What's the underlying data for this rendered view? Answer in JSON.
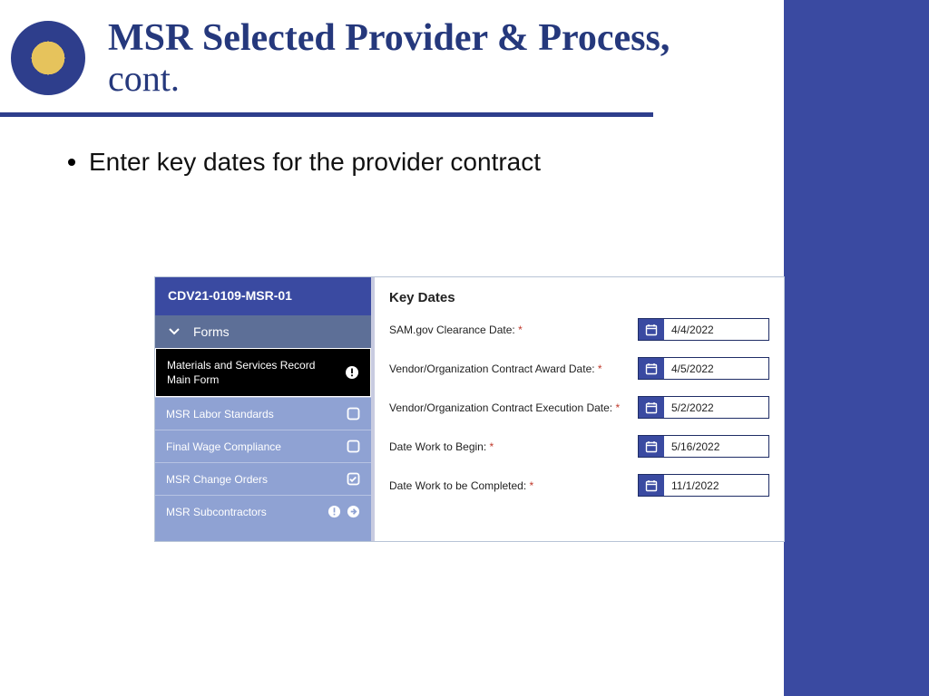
{
  "header": {
    "title_line1": "MSR Selected Provider & Process,",
    "title_line2": "cont."
  },
  "bullet": "Enter key dates for the provider contract",
  "colors": {
    "brand": "#3a4aa1",
    "brand_dark": "#25387c"
  },
  "panel": {
    "case_id": "CDV21-0109-MSR-01",
    "forms_label": "Forms",
    "active_item": "Materials and Services Record Main Form",
    "items": [
      {
        "label": "MSR Labor Standards",
        "icon": "checkbox-empty"
      },
      {
        "label": "Final Wage Compliance",
        "icon": "checkbox-empty"
      },
      {
        "label": "MSR Change Orders",
        "icon": "checkbox-checked"
      },
      {
        "label": "MSR Subcontractors",
        "icon": "alert-arrow"
      }
    ],
    "heading": "Key Dates",
    "fields": [
      {
        "label": "SAM.gov Clearance Date:",
        "value": "4/4/2022"
      },
      {
        "label": "Vendor/Organization Contract Award Date:",
        "value": "4/5/2022"
      },
      {
        "label": "Vendor/Organization Contract Execution Date:",
        "value": "5/2/2022"
      },
      {
        "label": "Date Work to Begin:",
        "value": "5/16/2022"
      },
      {
        "label": "Date Work to be Completed:",
        "value": "11/1/2022"
      }
    ]
  }
}
